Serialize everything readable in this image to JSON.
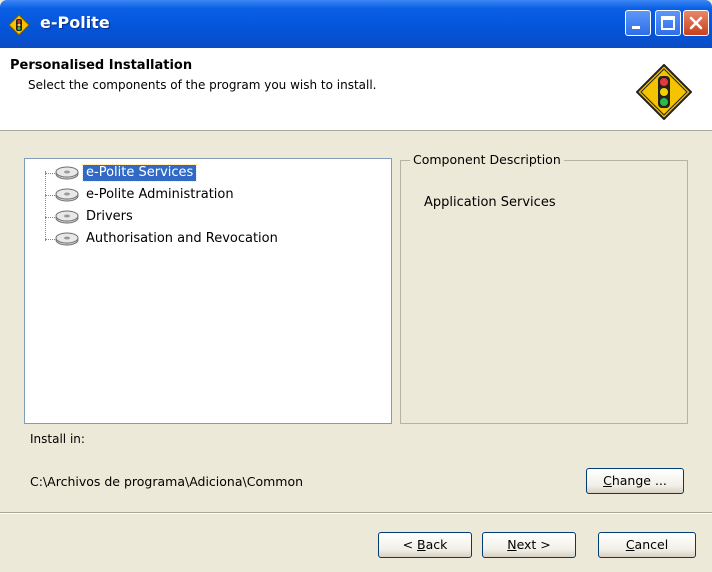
{
  "window": {
    "title": "e-Polite"
  },
  "header": {
    "title": "Personalised Installation",
    "subtitle": "Select the  components of the program you wish to install."
  },
  "tree": {
    "items": [
      {
        "label": "e-Polite Services",
        "selected": true,
        "icon": "disk-drive-icon"
      },
      {
        "label": "e-Polite Administration",
        "selected": false,
        "icon": "disk-drive-icon"
      },
      {
        "label": "Drivers",
        "selected": false,
        "icon": "disk-drive-icon"
      },
      {
        "label": "Authorisation and Revocation",
        "selected": false,
        "icon": "disk-drive-icon"
      }
    ]
  },
  "description": {
    "legend": "Component Description",
    "text": "Application Services"
  },
  "install": {
    "label": "Install in:",
    "path": "C:\\Archivos de programa\\Adiciona\\Common",
    "change_button": {
      "mnemonic": "C",
      "rest": "hange ..."
    }
  },
  "footer": {
    "back_button": {
      "prefix": "< ",
      "mnemonic": "B",
      "rest": "ack"
    },
    "next_button": {
      "mnemonic": "N",
      "rest": "ext >"
    },
    "cancel_button": {
      "mnemonic": "C",
      "rest": "ancel"
    }
  },
  "colors": {
    "title_bar": "#0454d8",
    "selection": "#316ac5",
    "dialog_background": "#ece9d8",
    "logo_diamond": "#f5c400"
  }
}
